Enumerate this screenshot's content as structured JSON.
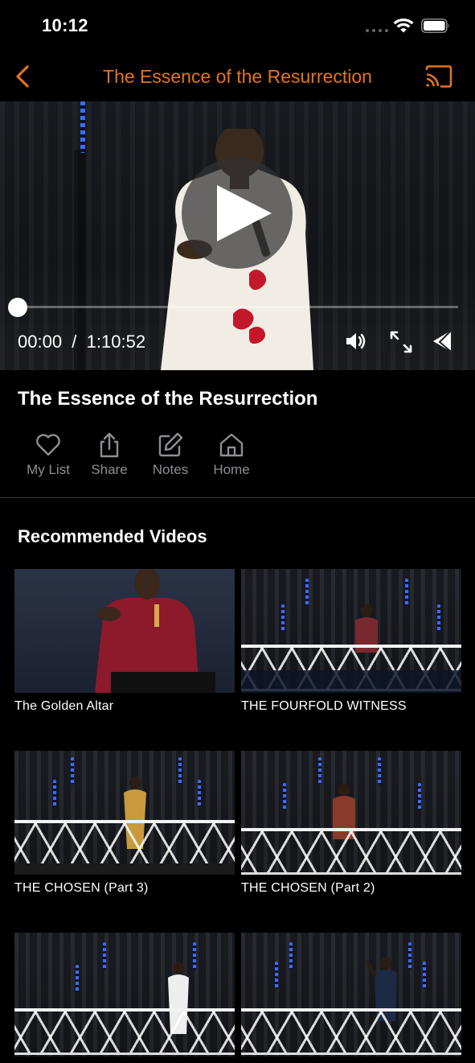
{
  "status_bar": {
    "time": "10:12"
  },
  "nav": {
    "title": "The Essence of the Resurrection"
  },
  "player": {
    "current_time": "00:00",
    "separator": "/",
    "duration": "1:10:52",
    "progress_fraction": 0.0
  },
  "video": {
    "title": "The Essence of the Resurrection"
  },
  "actions": [
    {
      "label": "My List",
      "icon": "heart-icon"
    },
    {
      "label": "Share",
      "icon": "share-icon"
    },
    {
      "label": "Notes",
      "icon": "edit-icon"
    },
    {
      "label": "Home",
      "icon": "home-icon"
    }
  ],
  "recommended": {
    "heading": "Recommended Videos",
    "videos": [
      {
        "title": "The Golden Altar"
      },
      {
        "title": "THE FOURFOLD WITNESS"
      },
      {
        "title": "THE CHOSEN (Part 3)"
      },
      {
        "title": "THE CHOSEN (Part 2)"
      },
      {
        "title": ""
      },
      {
        "title": ""
      }
    ]
  },
  "colors": {
    "accent": "#e2741c",
    "background": "#000000",
    "muted": "#8e8e93"
  }
}
